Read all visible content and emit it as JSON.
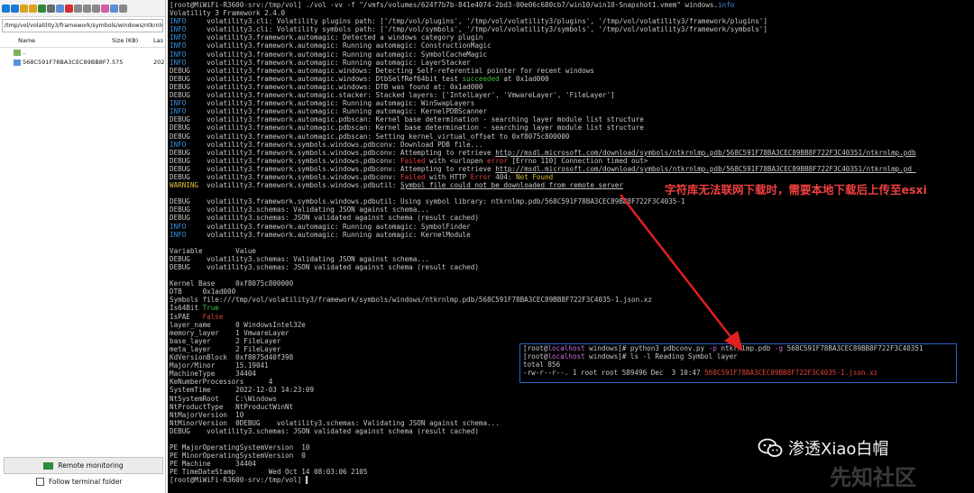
{
  "file_panel": {
    "path": "/tmp/vol/volatility3/framework/symbols/windows/ntkrnlmp",
    "columns": {
      "name": "Name",
      "size": "Size (KB)",
      "last": "Las"
    },
    "rows": [
      {
        "name": "..",
        "size": "",
        "last": ""
      },
      {
        "name": "568C591F78BA3CEC89BB8F7...",
        "size": "575",
        "last": "202"
      }
    ],
    "monitor_button": "Remote monitoring",
    "follow_label": "Follow terminal folder"
  },
  "terminal": {
    "lines": [
      [
        {
          "t": "[root@MiWiFi-R3600-srv:/tmp/vol] ./vol -vv -f \"/vmfs/volumes/624f7b7b-841e4074-2bd3-00e06c680cb7/win10/win10-Snapshot1.vmem\" windows."
        },
        {
          "t": "info",
          "c": "blu"
        }
      ],
      [
        {
          "t": "Volatility 3 Framework 2.4.0"
        }
      ],
      [
        {
          "t": "INFO",
          "c": "blu"
        },
        {
          "t": "     volatility3.cli: Volatility plugins path: ['/tmp/vol/plugins', '/tmp/vol/volatility3/plugins', '/tmp/vol/volatility3/framework/plugins']"
        }
      ],
      [
        {
          "t": "INFO",
          "c": "blu"
        },
        {
          "t": "     volatility3.cli: Volatility symbols path: ['/tmp/vol/symbols', '/tmp/vol/volatility3/symbols', '/tmp/vol/volatility3/framework/symbols']"
        }
      ],
      [
        {
          "t": "INFO",
          "c": "blu"
        },
        {
          "t": "     volatility3.framework.automagic: Detected a windows category plugin"
        }
      ],
      [
        {
          "t": "INFO",
          "c": "blu"
        },
        {
          "t": "     volatility3.framework.automagic: Running automagic: ConstructionMagic"
        }
      ],
      [
        {
          "t": "INFO",
          "c": "blu"
        },
        {
          "t": "     volatility3.framework.automagic: Running automagic: SymbolCacheMagic"
        }
      ],
      [
        {
          "t": "INFO",
          "c": "blu"
        },
        {
          "t": "     volatility3.framework.automagic: Running automagic: LayerStacker"
        }
      ],
      [
        {
          "t": "DEBUG    volatility3.framework.automagic.windows: Detecting Self-referential pointer for recent windows"
        }
      ],
      [
        {
          "t": "DEBUG    volatility3.framework.automagic.windows: DtbSelfRef64bit test "
        },
        {
          "t": "succeeded",
          "c": "grn"
        },
        {
          "t": " at 0x1ad000"
        }
      ],
      [
        {
          "t": "DEBUG    volatility3.framework.automagic.windows: DTB was found at: 0x1ad000"
        }
      ],
      [
        {
          "t": "DEBUG    volatility3.framework.automagic.stacker: Stacked layers: ['IntelLayer', 'VmwareLayer', 'FileLayer']"
        }
      ],
      [
        {
          "t": "INFO",
          "c": "blu"
        },
        {
          "t": "     volatility3.framework.automagic: Running automagic: WinSwapLayers"
        }
      ],
      [
        {
          "t": "INFO",
          "c": "blu"
        },
        {
          "t": "     volatility3.framework.automagic: Running automagic: KernelPDBScanner"
        }
      ],
      [
        {
          "t": "DEBUG    volatility3.framework.automagic.pdbscan: Kernel base determination - searching layer module list structure"
        }
      ],
      [
        {
          "t": "DEBUG    volatility3.framework.automagic.pdbscan: Kernel base determination - searching layer module list structure"
        }
      ],
      [
        {
          "t": "DEBUG    volatility3.framework.automagic.pdbscan: Setting kernel_virtual_offset to 0xf8075c800000"
        }
      ],
      [
        {
          "t": "INFO",
          "c": "blu"
        },
        {
          "t": "     volatility3.framework.symbols.windows.pdbconv: Download PDB file..."
        }
      ],
      [
        {
          "t": "DEBUG    volatility3.framework.symbols.windows.pdbconv: Attempting to retrieve "
        },
        {
          "t": "http://msdl.microsoft.com/download/symbols/ntkrnlmp.pdb/568C591F78BA3CEC89BB8F722F3C40351/ntkrnlmp.pdb",
          "c": "ulk"
        }
      ],
      [
        {
          "t": "DEBUG    volatility3.framework.symbols.windows.pdbconv: "
        },
        {
          "t": "Failed",
          "c": "red"
        },
        {
          "t": " with <urlopen "
        },
        {
          "t": "error",
          "c": "red"
        },
        {
          "t": " [Errno 110] Connection timed out>"
        }
      ],
      [
        {
          "t": "DEBUG    volatility3.framework.symbols.windows.pdbconv: Attempting to retrieve "
        },
        {
          "t": "http://msdl.microsoft.com/download/symbols/ntkrnlmp.pdb/568C591F78BA3CEC89BB8F722F3C40351/ntkrnlmp.pd_",
          "c": "ulk"
        }
      ],
      [
        {
          "t": "DEBUG    volatility3.framework.symbols.windows.pdbconv: "
        },
        {
          "t": "Failed",
          "c": "red"
        },
        {
          "t": " with HTTP "
        },
        {
          "t": "Error",
          "c": "red"
        },
        {
          "t": " 404: "
        },
        {
          "t": "Not Found",
          "c": "yel"
        }
      ],
      [
        {
          "t": "WARNING",
          "c": "yel"
        },
        {
          "t": "  volatility3.framework.symbols.windows.pdbutil: "
        },
        {
          "t": "Symbol file could not be downloaded from remote server",
          "c": "ulk"
        }
      ],
      [
        {
          "t": ""
        }
      ],
      [
        {
          "t": "DEBUG    volatility3.framework.symbols.windows.pdbutil: Using symbol library: ntkrnlmp.pdb/568C591F78BA3CEC89BB8F722F3C4035-1"
        }
      ],
      [
        {
          "t": "DEBUG    volatility3.schemas: Validating JSON against schema..."
        }
      ],
      [
        {
          "t": "DEBUG    volatility3.schemas: JSON validated against schema (result cached)"
        }
      ],
      [
        {
          "t": "INFO",
          "c": "blu"
        },
        {
          "t": "     volatility3.framework.automagic: Running automagic: SymbolFinder"
        }
      ],
      [
        {
          "t": "INFO",
          "c": "blu"
        },
        {
          "t": "     volatility3.framework.automagic: Running automagic: KernelModule"
        }
      ],
      [
        {
          "t": ""
        }
      ],
      [
        {
          "t": "Variable        Value"
        }
      ],
      [
        {
          "t": "DEBUG    volatility3.schemas: Validating JSON against schema..."
        }
      ],
      [
        {
          "t": "DEBUG    volatility3.schemas: JSON validated against schema (result cached)"
        }
      ],
      [
        {
          "t": ""
        }
      ],
      [
        {
          "t": "Kernel Base     0xf8075c800000"
        }
      ],
      [
        {
          "t": "DTB     0x1ad000"
        }
      ],
      [
        {
          "t": "Symbols file:///tmp/vol/volatility3/framework/symbols/windows/ntkrnlmp.pdb/568C591F78BA3CEC89BB8F722F3C4035-1.json.xz"
        }
      ],
      [
        {
          "t": "Is64Bit "
        },
        {
          "t": "True",
          "c": "grn"
        }
      ],
      [
        {
          "t": "IsPAE   "
        },
        {
          "t": "False",
          "c": "red"
        }
      ],
      [
        {
          "t": "layer_name      0 WindowsIntel32e"
        }
      ],
      [
        {
          "t": "memory_layer    1 VmwareLayer"
        }
      ],
      [
        {
          "t": "base_layer      2 FileLayer"
        }
      ],
      [
        {
          "t": "meta_layer      2 FileLayer"
        }
      ],
      [
        {
          "t": "KdVersionBlock  0xf8075d40f398"
        }
      ],
      [
        {
          "t": "Major/Minor     15.19041"
        }
      ],
      [
        {
          "t": "MachineType     34404"
        }
      ],
      [
        {
          "t": "KeNumberProcessors      4"
        }
      ],
      [
        {
          "t": "SystemTime      2022-12-03 14:23:09"
        }
      ],
      [
        {
          "t": "NtSystemRoot    C:\\Windows"
        }
      ],
      [
        {
          "t": "NtProductType   NtProductWinNt"
        }
      ],
      [
        {
          "t": "NtMajorVersion  10"
        }
      ],
      [
        {
          "t": "NtMinorVersion  0DEBUG    volatility3.schemas: Validating JSON against schema..."
        }
      ],
      [
        {
          "t": "DEBUG    volatility3.schemas: JSON validated against schema (result cached)"
        }
      ],
      [
        {
          "t": ""
        }
      ],
      [
        {
          "t": "PE MajorOperatingSystemVersion  10"
        }
      ],
      [
        {
          "t": "PE MinorOperatingSystemVersion  0"
        }
      ],
      [
        {
          "t": "PE Machine      34404"
        }
      ],
      [
        {
          "t": "PE TimeDateStamp        Wed Oct 14 08:03:06 2105"
        }
      ],
      [
        {
          "t": "[root@MiWiFi-R3600-srv:/tmp/vol] "
        },
        {
          "t": "▌"
        }
      ]
    ]
  },
  "annotation": "字符库无法联网下载时，需要本地下载后上传至esxi",
  "inset": {
    "lines": [
      [
        {
          "t": "[root@"
        },
        {
          "t": "localhost",
          "c": "pur"
        },
        {
          "t": " windows]# python3 pdbconv.py "
        },
        {
          "t": "-p",
          "c": "pur"
        },
        {
          "t": " ntkrnlmp.pdb "
        },
        {
          "t": "-g",
          "c": "pur"
        },
        {
          "t": " 568C591F78BA3CEC89BB8F722F3C40351"
        }
      ],
      [
        {
          "t": "[root@"
        },
        {
          "t": "localhost",
          "c": "pur"
        },
        {
          "t": " windows]# ls -l Reading Symbol layer"
        }
      ],
      [
        {
          "t": "total 856"
        }
      ],
      [
        {
          "t": "-rw-r--r--. 1 root root 589496 Dec  3 10:47 "
        },
        {
          "t": "568C591F78BA3CEC89BB8F722F3C4035-1.json.xz",
          "c": "red"
        }
      ]
    ]
  },
  "watermark": {
    "text": "渗透Xiao白帽",
    "site": "先知社区"
  },
  "colors": {
    "info": "#3a8fe0",
    "success": "#3ec13e",
    "error": "#e0423c",
    "warning": "#e2c238",
    "arrow": "#e02020"
  },
  "icons": {
    "toolbar": [
      "download-icon",
      "upload-icon",
      "folder-icon",
      "folder-new-icon",
      "refresh-icon",
      "home-icon",
      "file-new-icon",
      "delete-icon",
      "edit-icon",
      "copy-icon",
      "paste-icon",
      "select-icon",
      "search-icon",
      "terminal-icon"
    ]
  }
}
